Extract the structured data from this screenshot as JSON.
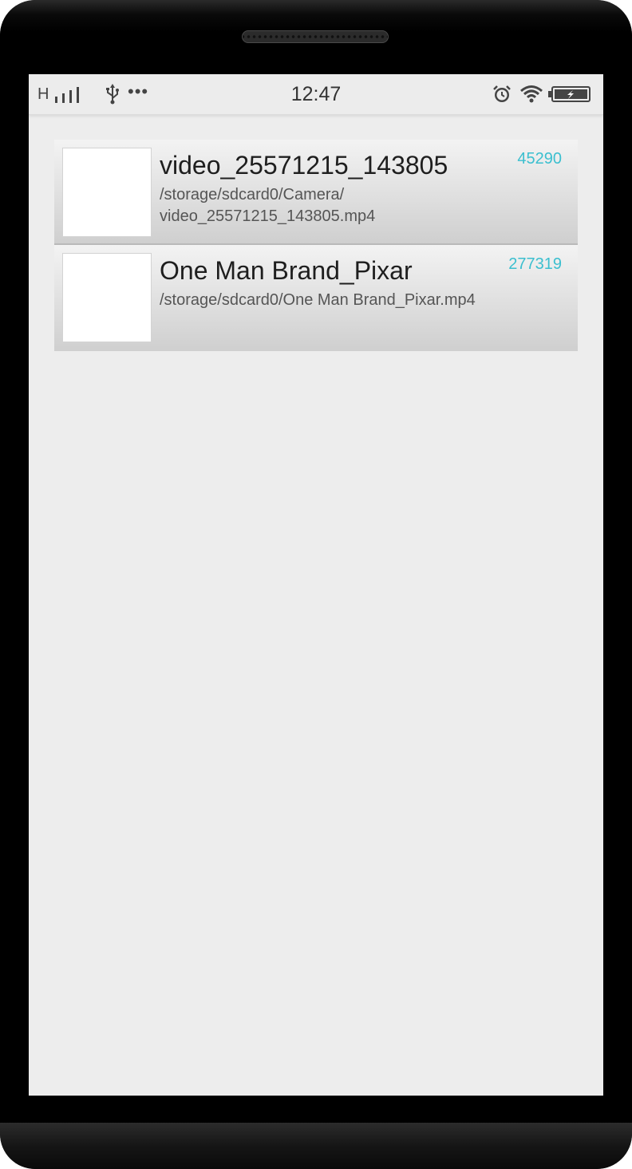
{
  "status_bar": {
    "network": "H",
    "time": "12:47",
    "icons": [
      "signal-icon",
      "usb-icon",
      "more-notifications-icon",
      "alarm-icon",
      "wifi-icon",
      "battery-charging-icon"
    ],
    "more_dots": "•••"
  },
  "videos": [
    {
      "title": "video_25571215_143805",
      "path_line1": "/storage/sdcard0/Camera/",
      "path_line2": "video_25571215_143805.mp4",
      "size": "45290"
    },
    {
      "title": "One Man Brand_Pixar",
      "path_line1": "/storage/sdcard0/One Man Brand_Pixar.mp4",
      "path_line2": "",
      "size": "277319"
    }
  ],
  "colors": {
    "accent": "#3bbfcf",
    "screen_bg": "#ededed"
  }
}
